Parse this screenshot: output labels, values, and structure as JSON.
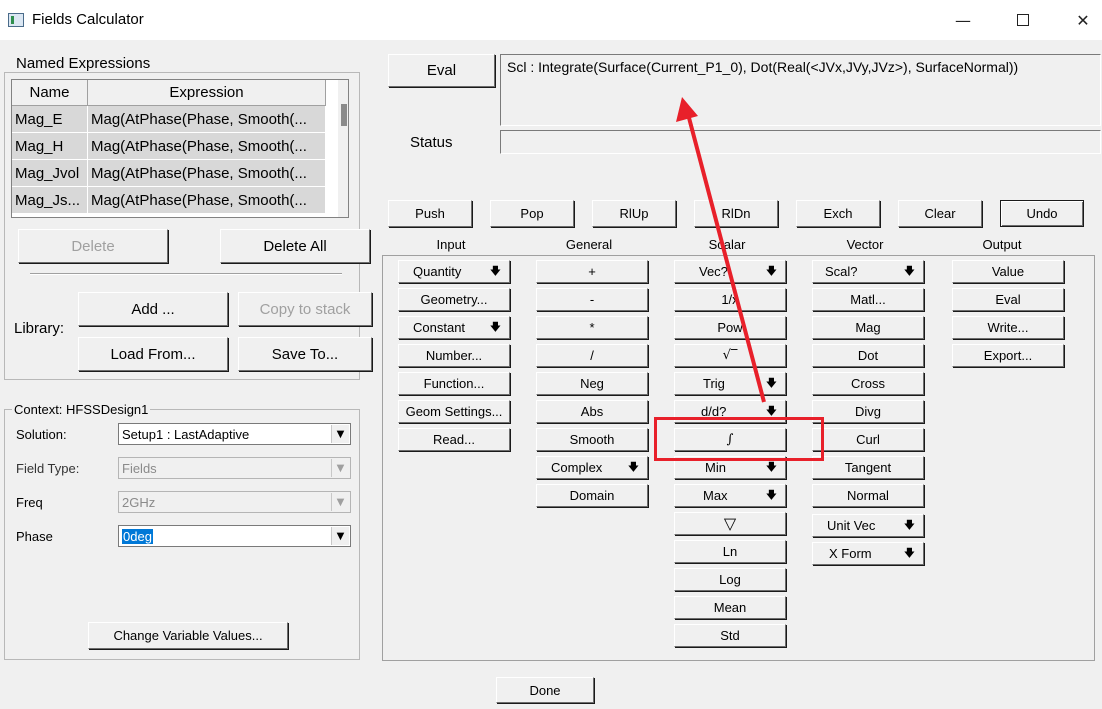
{
  "window": {
    "title": "Fields Calculator",
    "minimize_icon": "minimize-icon",
    "maximize_icon": "maximize-icon",
    "close_icon": "close-icon"
  },
  "named_expressions": {
    "group_label": "Named Expressions",
    "columns": [
      "Name",
      "Expression"
    ],
    "rows": [
      {
        "name": "Mag_E",
        "expression": "Mag(AtPhase(Phase, Smooth(..."
      },
      {
        "name": "Mag_H",
        "expression": "Mag(AtPhase(Phase, Smooth(..."
      },
      {
        "name": "Mag_Jvol",
        "expression": "Mag(AtPhase(Phase, Smooth(..."
      },
      {
        "name": "Mag_Js...",
        "expression": "Mag(AtPhase(Phase, Smooth(..."
      }
    ],
    "delete": "Delete",
    "delete_all": "Delete All",
    "library_label": "Library:",
    "add": "Add ...",
    "copy_to_stack": "Copy to stack",
    "load_from": "Load From...",
    "save_to": "Save To..."
  },
  "context": {
    "group_label": "Context: HFSSDesign1",
    "solution_label": "Solution:",
    "solution_value": "Setup1 : LastAdaptive",
    "field_type_label": "Field Type:",
    "field_type_value": "Fields",
    "freq_label": "Freq",
    "freq_value": "2GHz",
    "phase_label": "Phase",
    "phase_value": "0deg",
    "change_variable_values": "Change Variable Values..."
  },
  "top": {
    "eval": "Eval",
    "expression": "Scl : Integrate(Surface(Current_P1_0), Dot(Real(<JVx,JVy,JVz>), SurfaceNormal))",
    "status_label": "Status",
    "status_value": ""
  },
  "stack_buttons": [
    "Push",
    "Pop",
    "RlUp",
    "RlDn",
    "Exch",
    "Clear",
    "Undo"
  ],
  "columns": {
    "input": {
      "heading": "Input",
      "buttons": [
        "Quantity",
        "Geometry...",
        "Constant",
        "Number...",
        "Function...",
        "Geom Settings...",
        "Read..."
      ]
    },
    "general": {
      "heading": "General",
      "buttons": [
        "+",
        "-",
        "*",
        "/",
        "Neg",
        "Abs",
        "Smooth",
        "Complex",
        "Domain"
      ]
    },
    "scalar": {
      "heading": "Scalar",
      "buttons": [
        "Vec?",
        "1/x",
        "Pow",
        "√‾",
        "Trig",
        "d/d?",
        "∫",
        "Min",
        "Max",
        "▽",
        "Ln",
        "Log",
        "Mean",
        "Std"
      ]
    },
    "vector": {
      "heading": "Vector",
      "buttons": [
        "Scal?",
        "Matl...",
        "Mag",
        "Dot",
        "Cross",
        "Divg",
        "Curl",
        "Tangent",
        "Normal",
        "Unit Vec",
        "X Form"
      ]
    },
    "output": {
      "heading": "Output",
      "buttons": [
        "Value",
        "Eval",
        "Write...",
        "Export..."
      ]
    }
  },
  "done": "Done",
  "annotation": {
    "highlight_color": "#e8202a",
    "arrow_color": "#e8202a"
  }
}
